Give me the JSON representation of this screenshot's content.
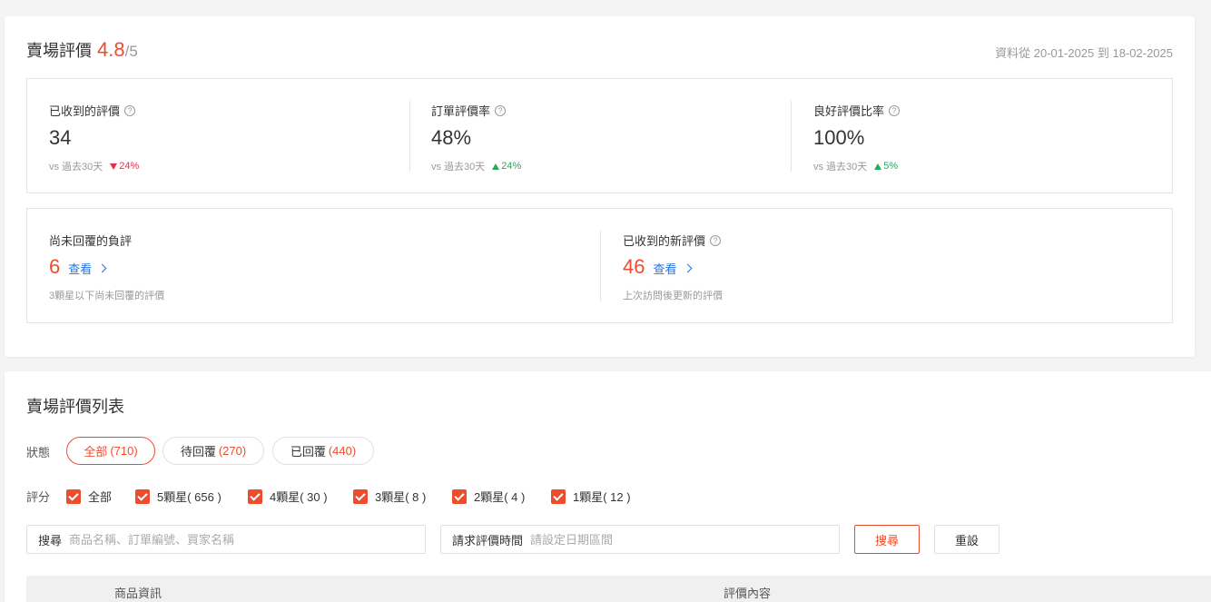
{
  "summary": {
    "title": "賣場評價",
    "score": "4.8",
    "score_max": "/5",
    "date_range": "資料從 20-01-2025 到 18-02-2025",
    "metrics": [
      {
        "label": "已收到的評價",
        "value": "34",
        "compare": "vs 過去30天",
        "trend": "down",
        "change": "24%"
      },
      {
        "label": "訂單評價率",
        "value": "48%",
        "compare": "vs 過去30天",
        "trend": "up",
        "change": "24%"
      },
      {
        "label": "良好評價比率",
        "value": "100%",
        "compare": "vs 過去30天",
        "trend": "up",
        "change": "5%"
      }
    ],
    "pending": [
      {
        "label": "尚未回覆的負評",
        "value": "6",
        "link": "查看",
        "desc": "3顆星以下尚未回覆的評價",
        "help": false
      },
      {
        "label": "已收到的新評價",
        "value": "46",
        "link": "查看",
        "desc": "上次訪問後更新的評價",
        "help": true
      }
    ]
  },
  "list": {
    "title": "賣場評價列表",
    "status_label": "狀態",
    "status_tabs": [
      {
        "label": "全部",
        "count": "(710)",
        "active": true
      },
      {
        "label": "待回覆",
        "count": "(270)",
        "active": false
      },
      {
        "label": "已回覆",
        "count": "(440)",
        "active": false
      }
    ],
    "rating_label": "評分",
    "rating_filters": [
      {
        "label": "全部",
        "checked": true
      },
      {
        "label": "5顆星( 656 )",
        "checked": true
      },
      {
        "label": "4顆星( 30 )",
        "checked": true
      },
      {
        "label": "3顆星( 8 )",
        "checked": true
      },
      {
        "label": "2顆星( 4 )",
        "checked": true
      },
      {
        "label": "1顆星( 12 )",
        "checked": true
      }
    ],
    "search": {
      "label": "搜尋",
      "placeholder": "商品名稱、訂單編號、買家名稱",
      "value": ""
    },
    "date_filter": {
      "label": "請求評價時間",
      "placeholder": "請設定日期區間",
      "value": ""
    },
    "search_button": "搜尋",
    "reset_button": "重設",
    "table_headers": [
      "商品資訊",
      "評價內容"
    ]
  },
  "colors": {
    "accent": "#ee4d2d",
    "link": "#2673dd",
    "trend_up": "#26aa5b",
    "trend_down": "#ee2c4a"
  },
  "icons": [
    "help-circle-icon",
    "triangle-down-icon",
    "triangle-up-icon",
    "chevron-right-icon",
    "checkbox-checked-icon"
  ]
}
